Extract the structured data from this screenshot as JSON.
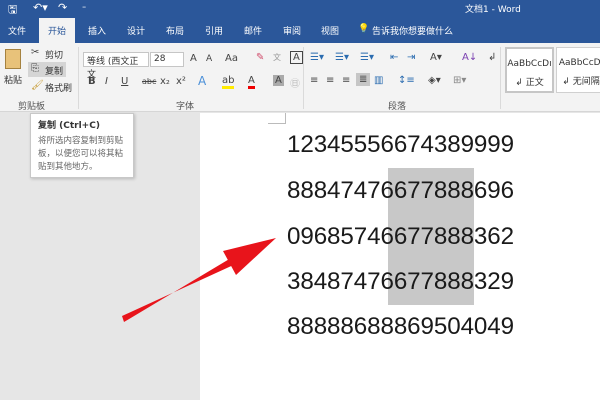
{
  "titlebar": {
    "title": "文档1  -  Word",
    "save_icon": "save-icon",
    "undo_icon": "undo-icon",
    "redo_icon": "redo-icon",
    "customize_icon": "customize-qat-icon"
  },
  "tabs": [
    "文件",
    "开始",
    "插入",
    "设计",
    "布局",
    "引用",
    "邮件",
    "审阅",
    "视图"
  ],
  "tell_me": "告诉我你想要做什么",
  "clipboard": {
    "paste": "粘贴",
    "cut": "剪切",
    "copy": "复制",
    "format_painter": "格式刷",
    "label": "剪贴板"
  },
  "font": {
    "name": "等线 (西文正文",
    "size": "28",
    "bold": "B",
    "italic": "I",
    "underline": "U",
    "strike": "abc",
    "sub": "x₂",
    "sup": "x²",
    "grow": "A",
    "shrink": "A",
    "case": "Aa",
    "label": "字体"
  },
  "paragraph": {
    "label": "段落"
  },
  "styles": [
    {
      "preview": "AaBbCcDı",
      "name": "↲ 正文"
    },
    {
      "preview": "AaBbCcDı",
      "name": "↲ 无间隔"
    }
  ],
  "tooltip": {
    "title": "复制 (Ctrl+C)",
    "desc": "将所选内容复制到剪贴板，以便您可以将其粘贴到其他地方。"
  },
  "document": {
    "lines": [
      "12345556674389999",
      "88847476677888696",
      "09685746677888362",
      "38487476677888329",
      "88888688869504049"
    ]
  },
  "colors": {
    "brand": "#2b579a",
    "arrow": "#e8141b",
    "highlight": "#c8c8c8"
  }
}
